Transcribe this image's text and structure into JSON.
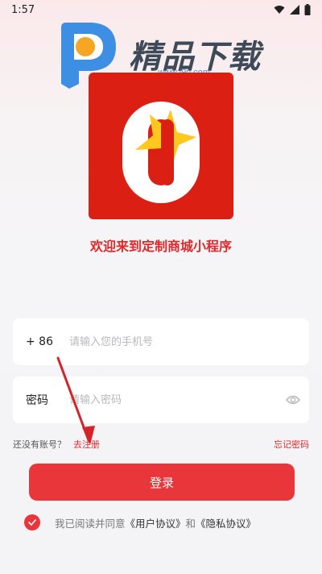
{
  "status_bar": {
    "time": "1:57"
  },
  "watermark": {
    "title": "精品下载",
    "url": "www.j9p.com"
  },
  "welcome_text": "欢迎来到定制商城小程序",
  "phone_field": {
    "prefix": "+ 86",
    "placeholder": "请输入您的手机号",
    "value": ""
  },
  "password_field": {
    "label": "密码",
    "placeholder": "请输入密码",
    "value": ""
  },
  "register": {
    "no_account": "还没有账号？",
    "link": "去注册"
  },
  "forgot_password": "忘记密码",
  "login_button": "登录",
  "agreement": {
    "prefix": "我已阅读并同意",
    "user_agreement": "《用户协议》",
    "and": "和",
    "privacy_policy": "《隐私协议》",
    "checked": true
  },
  "colors": {
    "accent": "#e8363a",
    "logo_bg": "#dc1f13",
    "star": "#ffc81e"
  },
  "icons": [
    "wifi-icon",
    "signal-icon",
    "battery-icon",
    "eye-icon",
    "check-icon",
    "star-icon"
  ]
}
